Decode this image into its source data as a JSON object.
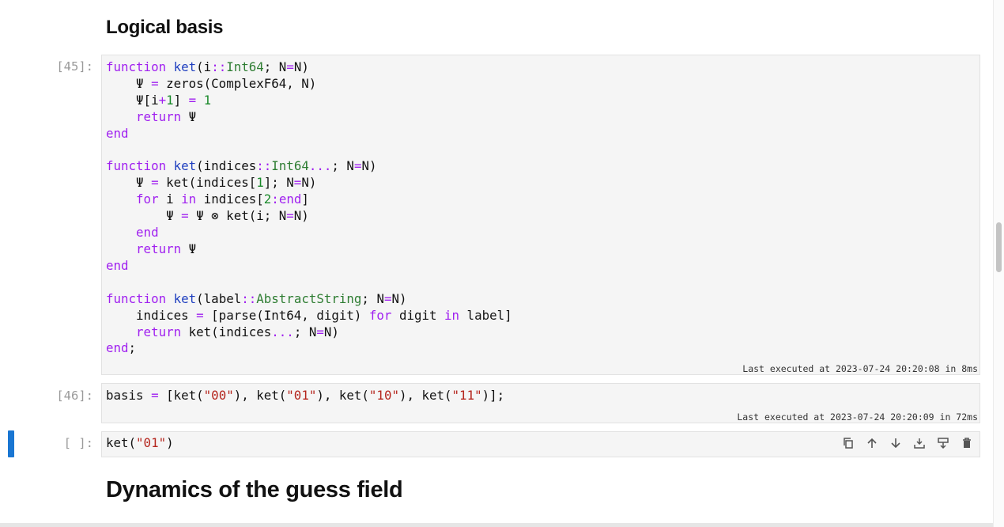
{
  "headings": {
    "logical_basis": "Logical basis",
    "dynamics": "Dynamics of the guess field"
  },
  "cells": [
    {
      "prompt": "[45]:",
      "exec_info": "Last executed at 2023-07-24 20:20:08 in 8ms",
      "code": "function ket(i::Int64; N=N)\n    Ψ = zeros(ComplexF64, N)\n    Ψ[i+1] = 1\n    return Ψ\nend\n\nfunction ket(indices::Int64...; N=N)\n    Ψ = ket(indices[1]; N=N)\n    for i in indices[2:end]\n        Ψ = Ψ ⊗ ket(i; N=N)\n    end\n    return Ψ\nend\n\nfunction ket(label::AbstractString; N=N)\n    indices = [parse(Int64, digit) for digit in label]\n    return ket(indices...; N=N)\nend;"
    },
    {
      "prompt": "[46]:",
      "exec_info": "Last executed at 2023-07-24 20:20:09 in 72ms",
      "code": "basis = [ket(\"00\"), ket(\"01\"), ket(\"10\"), ket(\"11\")];"
    },
    {
      "prompt": "[ ]:",
      "code": "ket(\"01\")"
    }
  ],
  "toolbar": [
    "copy-icon",
    "move-up-icon",
    "move-down-icon",
    "insert-below-icon",
    "split-cell-icon",
    "delete-icon"
  ]
}
